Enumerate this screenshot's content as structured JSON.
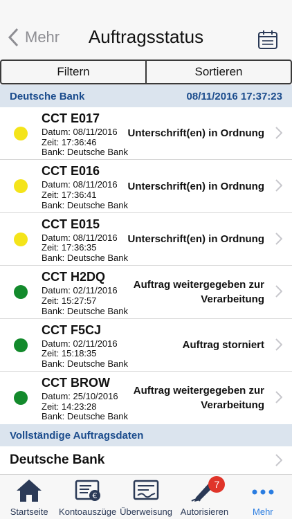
{
  "nav": {
    "back_label": "Mehr",
    "title": "Auftragsstatus",
    "calendar_icon": "calendar-icon"
  },
  "segment": {
    "filter_label": "Filtern",
    "sort_label": "Sortieren"
  },
  "section_bank": {
    "name": "Deutsche Bank",
    "timestamp": "08/11/2016 17:37:23"
  },
  "orders": [
    {
      "code": "CCT E017",
      "date": "Datum: 08/11/2016",
      "time": "Zeit: 17:36:46",
      "bank": "Bank: Deutsche Bank",
      "status": "Unterschrift(en) in Ordnung",
      "color": "#f4e41a"
    },
    {
      "code": "CCT E016",
      "date": "Datum: 08/11/2016",
      "time": "Zeit: 17:36:41",
      "bank": "Bank: Deutsche Bank",
      "status": "Unterschrift(en) in Ordnung",
      "color": "#f4e41a"
    },
    {
      "code": "CCT E015",
      "date": "Datum: 08/11/2016",
      "time": "Zeit: 17:36:35",
      "bank": "Bank: Deutsche Bank",
      "status": "Unterschrift(en) in Ordnung",
      "color": "#f4e41a"
    },
    {
      "code": "CCT H2DQ",
      "date": "Datum: 02/11/2016",
      "time": "Zeit: 15:27:57",
      "bank": "Bank: Deutsche Bank",
      "status": "Auftrag weitergegeben zur Verarbeitung",
      "color": "#138a2c"
    },
    {
      "code": "CCT F5CJ",
      "date": "Datum: 02/11/2016",
      "time": "Zeit: 15:18:35",
      "bank": "Bank: Deutsche Bank",
      "status": "Auftrag storniert",
      "color": "#138a2c"
    },
    {
      "code": "CCT BROW",
      "date": "Datum: 25/10/2016",
      "time": "Zeit: 14:23:28",
      "bank": "Bank: Deutsche Bank",
      "status": "Auftrag weitergegeben zur Verarbeitung",
      "color": "#138a2c"
    }
  ],
  "section_full": {
    "title": "Vollständige Auftragsdaten"
  },
  "full_row": {
    "label": "Deutsche Bank"
  },
  "tabs": [
    {
      "label": "Startseite",
      "icon": "home-icon"
    },
    {
      "label": "Kontoauszüge",
      "icon": "statement-icon"
    },
    {
      "label": "Überweisung",
      "icon": "transfer-icon"
    },
    {
      "label": "Autorisieren",
      "icon": "sign-pen-icon",
      "badge": "7"
    },
    {
      "label": "Mehr",
      "icon": "more-icon"
    }
  ],
  "colors": {
    "accent": "#2a7de1",
    "section_bg": "#dbe4ee",
    "section_text": "#1a4b8c",
    "badge": "#e0352a"
  }
}
